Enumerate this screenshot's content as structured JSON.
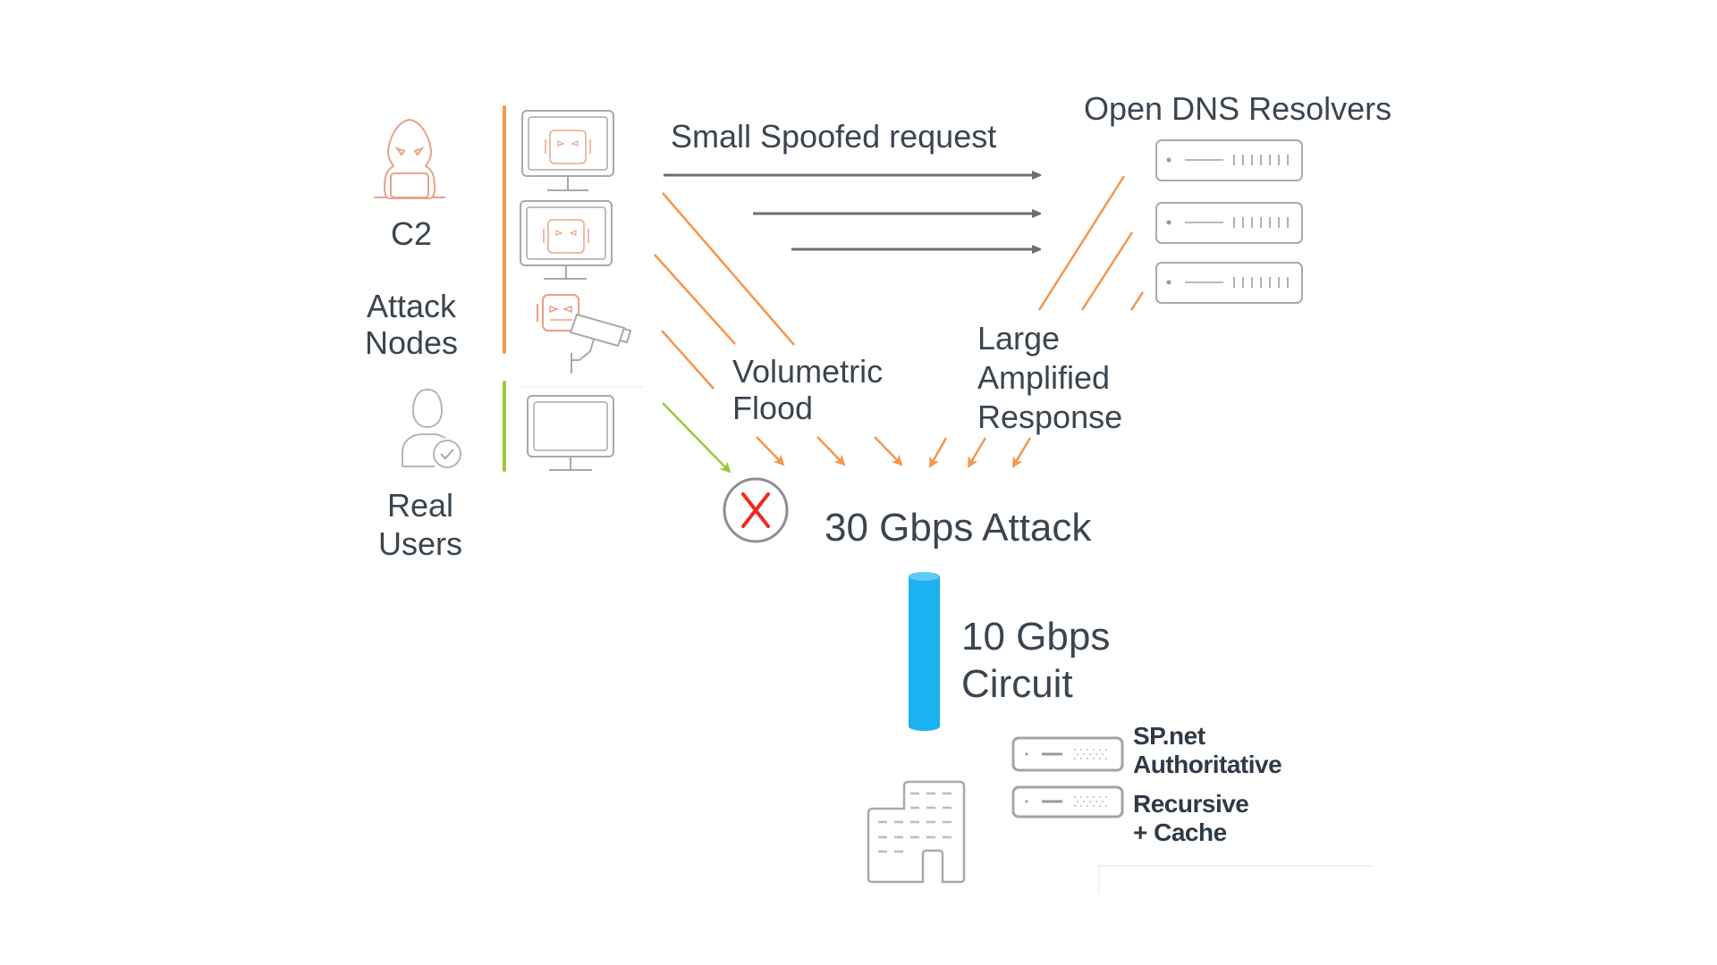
{
  "colors": {
    "attack": "#f7954a",
    "legit": "#9bc93a",
    "neutral_arrow": "#6b6f73",
    "icon_gray": "#a9a9a9",
    "icon_attack": "#e99f86",
    "block": "#f02a1e",
    "circuit": "#1ab2f0",
    "text": "#3a4550"
  },
  "actors": {
    "c2": {
      "icon": "hooded-hacker-icon",
      "label": "C2"
    },
    "attack_nodes": {
      "label_line1": "Attack",
      "label_line2": "Nodes",
      "devices": [
        "infected-monitor-icon",
        "infected-monitor-icon",
        "infected-camera-icon"
      ]
    },
    "real_users": {
      "icon": "verified-user-icon",
      "label_line1": "Real",
      "label_line2": "Users",
      "devices": [
        "monitor-icon"
      ]
    }
  },
  "flows": {
    "spoofed_request": {
      "label": "Small Spoofed request",
      "arrow_count": 3
    },
    "volumetric_flood": {
      "label_line1": "Volumetric",
      "label_line2": "Flood"
    },
    "amplified_response": {
      "label_line1": "Large",
      "label_line2": "Amplified",
      "label_line3": "Response"
    }
  },
  "resolvers": {
    "title": "Open DNS Resolvers",
    "count": 3
  },
  "attack": {
    "label": "30 Gbps Attack",
    "blocked_icon": "x-circle-icon"
  },
  "circuit": {
    "label_line1": "10 Gbps",
    "label_line2": "Circuit"
  },
  "destination": {
    "icon": "office-building-icon",
    "servers": [
      {
        "line1": "SP.net",
        "line2": "Authoritative"
      },
      {
        "line1": "Recursive",
        "line2": "+ Cache"
      }
    ]
  }
}
